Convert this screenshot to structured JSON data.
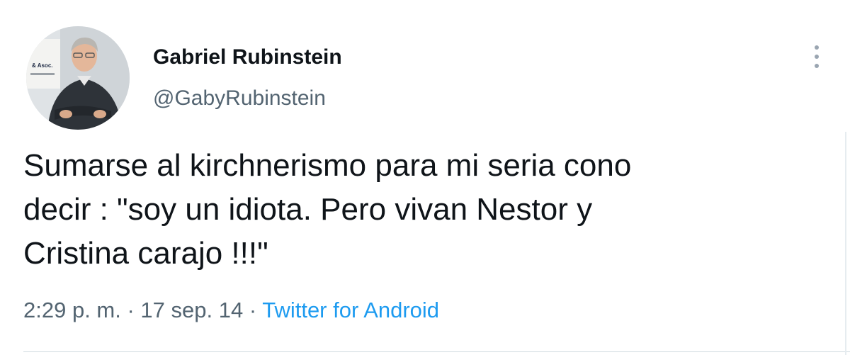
{
  "tweet": {
    "author": {
      "display_name": "Gabriel Rubinstein",
      "handle": "@GabyRubinstein",
      "avatar_sign_text": "& Asoc."
    },
    "text": "Sumarse al kirchnerismo para mi seria cono\ndecir : \"soy un idiota. Pero vivan Nestor y\nCristina carajo !!!\"",
    "time": "2:29 p. m.",
    "separator": " · ",
    "date": "17 sep. 14",
    "source": "Twitter for Android"
  },
  "icons": {
    "more": "more-vertical-icon"
  },
  "colors": {
    "text_primary": "#0f1419",
    "text_secondary": "#536471",
    "link": "#1d9bf0",
    "divider": "#cfd9de"
  }
}
